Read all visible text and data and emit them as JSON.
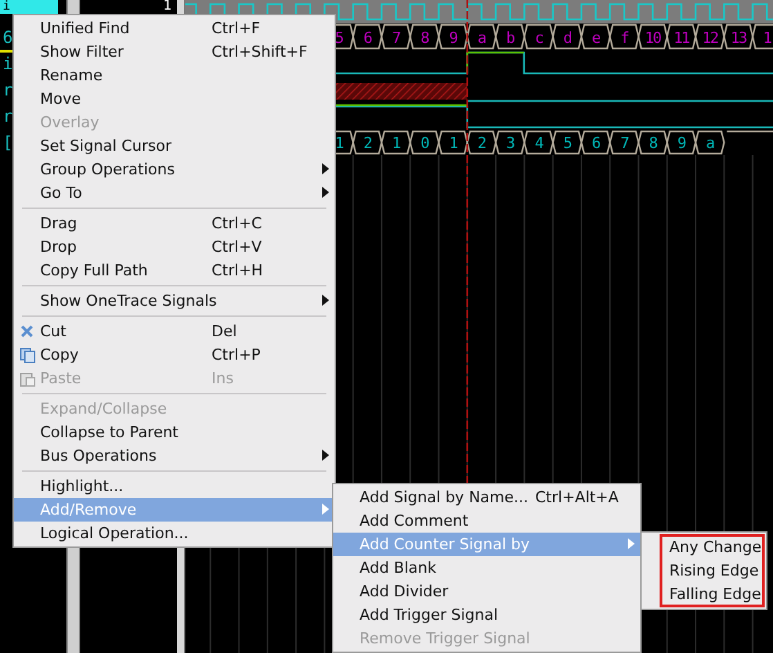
{
  "signals": [
    {
      "name": "i",
      "value": "1",
      "selected": true
    },
    {
      "name": "6",
      "selected": false
    },
    {
      "name": "i",
      "selected": false
    },
    {
      "name": "r",
      "selected": false
    },
    {
      "name": "r",
      "selected": false
    },
    {
      "name": "[",
      "selected": false
    }
  ],
  "buses": [
    {
      "values": [
        "5",
        "6",
        "7",
        "8",
        "9",
        "a",
        "b",
        "c",
        "d",
        "e",
        "f",
        "10",
        "11",
        "12",
        "13",
        "1"
      ]
    },
    {
      "values": [
        "1",
        "2",
        "1",
        "0",
        "1",
        "2",
        "3",
        "4",
        "5",
        "6",
        "7",
        "8",
        "9",
        "a"
      ]
    }
  ],
  "menu": {
    "items": [
      {
        "kind": "item",
        "label": "Unified Find",
        "shortcut": "Ctrl+F",
        "disabled": false,
        "selected": false
      },
      {
        "kind": "item",
        "label": "Show Filter",
        "shortcut": "Ctrl+Shift+F",
        "disabled": false,
        "selected": false
      },
      {
        "kind": "item",
        "label": "Rename",
        "disabled": false,
        "selected": false
      },
      {
        "kind": "item",
        "label": "Move",
        "disabled": false,
        "selected": false
      },
      {
        "kind": "item",
        "label": "Overlay",
        "disabled": true,
        "selected": false
      },
      {
        "kind": "item",
        "label": "Set Signal Cursor",
        "disabled": false,
        "selected": false
      },
      {
        "kind": "submenu",
        "label": "Group Operations",
        "disabled": false,
        "selected": false
      },
      {
        "kind": "submenu",
        "label": "Go To",
        "disabled": false,
        "selected": false
      },
      {
        "kind": "separator"
      },
      {
        "kind": "item",
        "label": "Drag",
        "shortcut": "Ctrl+C",
        "disabled": false,
        "selected": false
      },
      {
        "kind": "item",
        "label": "Drop",
        "shortcut": "Ctrl+V",
        "disabled": false,
        "selected": false
      },
      {
        "kind": "item",
        "label": "Copy Full Path",
        "shortcut": "Ctrl+H",
        "disabled": false,
        "selected": false
      },
      {
        "kind": "separator"
      },
      {
        "kind": "submenu",
        "label": "Show OneTrace Signals",
        "disabled": false,
        "selected": false
      },
      {
        "kind": "separator"
      },
      {
        "kind": "cut",
        "label": "Cut",
        "shortcut": "Del",
        "disabled": false,
        "selected": false
      },
      {
        "kind": "copy",
        "label": "Copy",
        "shortcut": "Ctrl+P",
        "disabled": false,
        "selected": false
      },
      {
        "kind": "paste",
        "label": "Paste",
        "shortcut": "Ins",
        "disabled": true,
        "selected": false
      },
      {
        "kind": "separator"
      },
      {
        "kind": "item",
        "label": "Expand/Collapse",
        "disabled": true,
        "selected": false
      },
      {
        "kind": "item",
        "label": "Collapse to Parent",
        "disabled": false,
        "selected": false
      },
      {
        "kind": "submenu",
        "label": "Bus Operations",
        "disabled": false,
        "selected": false
      },
      {
        "kind": "separator"
      },
      {
        "kind": "item",
        "label": "Highlight...",
        "disabled": false,
        "selected": false
      },
      {
        "kind": "submenu",
        "label": "Add/Remove",
        "disabled": false,
        "selected": true
      },
      {
        "kind": "item",
        "label": "Logical Operation...",
        "disabled": false,
        "selected": false
      }
    ]
  },
  "add_remove_menu": {
    "items": [
      {
        "kind": "item",
        "label": "Add Signal by Name...",
        "shortcut": "Ctrl+Alt+A",
        "disabled": false,
        "selected": false
      },
      {
        "kind": "item",
        "label": "Add Comment",
        "disabled": false,
        "selected": false
      },
      {
        "kind": "submenu",
        "label": "Add Counter Signal by",
        "disabled": false,
        "selected": true
      },
      {
        "kind": "item",
        "label": "Add Blank",
        "disabled": false,
        "selected": false
      },
      {
        "kind": "item",
        "label": "Add Divider",
        "disabled": false,
        "selected": false
      },
      {
        "kind": "item",
        "label": "Add Trigger Signal",
        "disabled": false,
        "selected": false
      },
      {
        "kind": "item",
        "label": "Remove Trigger Signal",
        "disabled": true,
        "selected": false
      }
    ]
  },
  "counter_menu": {
    "framed": true,
    "items": [
      {
        "kind": "item",
        "label": "Any Change",
        "disabled": false,
        "selected": false
      },
      {
        "kind": "item",
        "label": "Rising Edge",
        "disabled": false,
        "selected": false
      },
      {
        "kind": "item",
        "label": "Falling Edge",
        "disabled": false,
        "selected": false
      }
    ]
  }
}
